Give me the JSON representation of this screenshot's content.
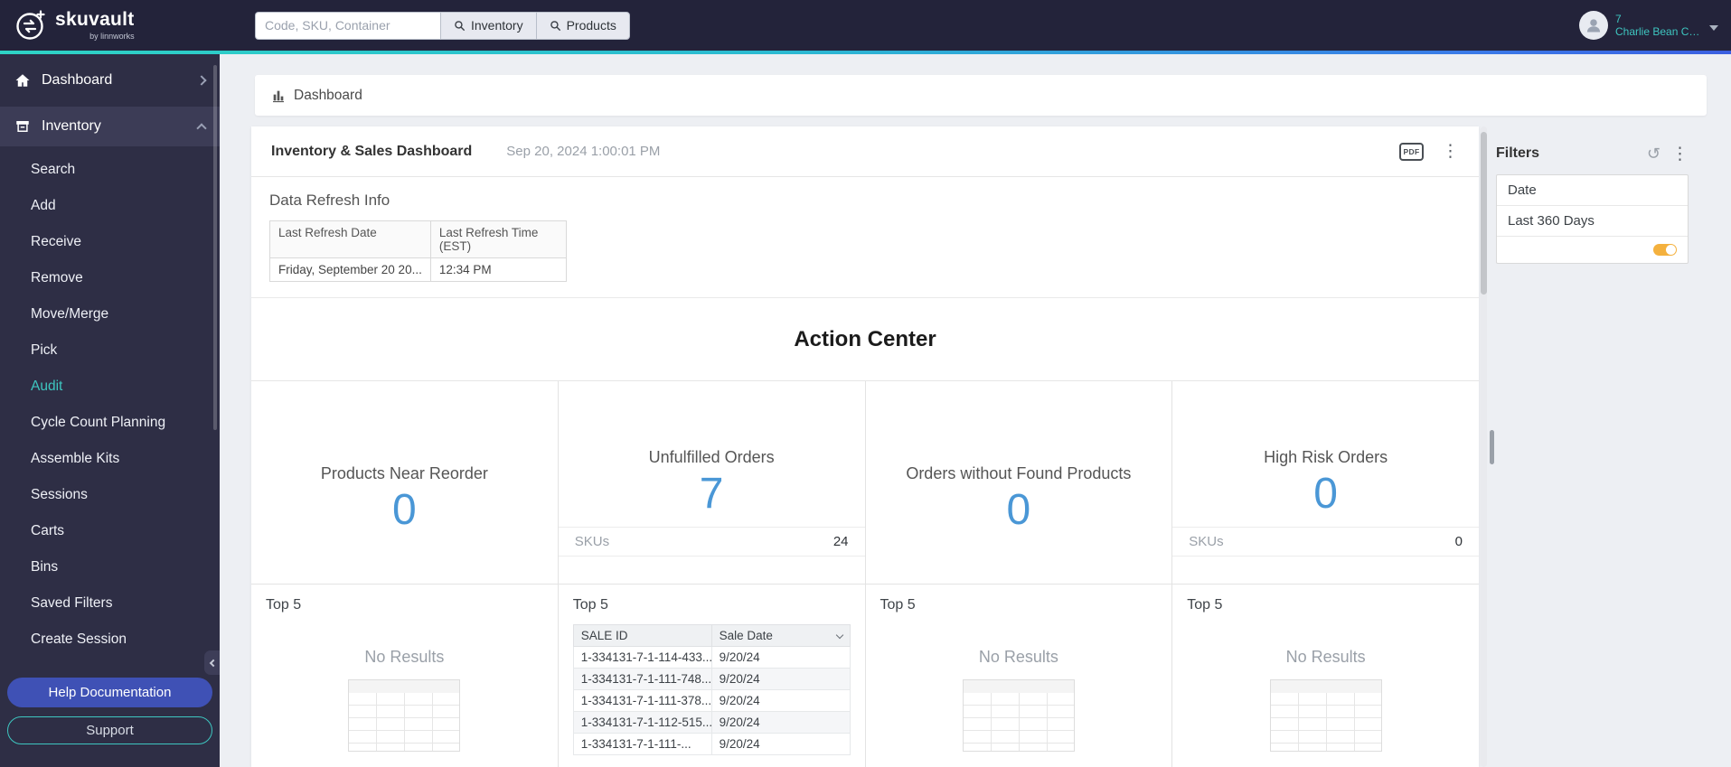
{
  "topbar": {
    "brand": {
      "name": "skuvault",
      "tagline": "by linnworks"
    },
    "search_placeholder": "Code, SKU, Container",
    "inventory_button": "Inventory",
    "products_button": "Products",
    "user": {
      "badge": "7",
      "name": "Charlie Bean Co..."
    }
  },
  "sidebar": {
    "dashboard_label": "Dashboard",
    "inventory_label": "Inventory",
    "items": [
      "Search",
      "Add",
      "Receive",
      "Remove",
      "Move/Merge",
      "Pick",
      "Audit",
      "Cycle Count Planning",
      "Assemble Kits",
      "Sessions",
      "Carts",
      "Bins",
      "Saved Filters",
      "Create Session"
    ],
    "active_item": "Audit",
    "help_button": "Help Documentation",
    "support_button": "Support"
  },
  "breadcrumb": {
    "label": "Dashboard"
  },
  "panel": {
    "title": "Inventory & Sales Dashboard",
    "timestamp": "Sep 20, 2024 1:00:01 PM",
    "pdf_label": "PDF",
    "refresh": {
      "heading": "Data Refresh Info",
      "col1": "Last Refresh Date",
      "col2": "Last Refresh Time (EST)",
      "date": "Friday, September 20 20...",
      "time": "12:34 PM"
    },
    "action_center_title": "Action Center",
    "kpis": [
      {
        "label": "Products Near Reorder",
        "value": "0"
      },
      {
        "label": "Unfulfilled Orders",
        "value": "7",
        "sub_label": "SKUs",
        "sub_value": "24"
      },
      {
        "label": "Orders without Found Products",
        "value": "0"
      },
      {
        "label": "High Risk Orders",
        "value": "0",
        "sub_label": "SKUs",
        "sub_value": "0"
      }
    ],
    "top5_label": "Top 5",
    "no_results": "No Results",
    "orders": {
      "col1": "SALE ID",
      "col2": "Sale Date",
      "rows": [
        {
          "id": "1-334131-7-1-114-433...",
          "date": "9/20/24"
        },
        {
          "id": "1-334131-7-1-111-748...",
          "date": "9/20/24"
        },
        {
          "id": "1-334131-7-1-111-378...",
          "date": "9/20/24"
        },
        {
          "id": "1-334131-7-1-112-515...",
          "date": "9/20/24"
        },
        {
          "id": "1-334131-7-1-111-...",
          "date": "9/20/24"
        }
      ]
    }
  },
  "filters": {
    "title": "Filters",
    "date_label": "Date",
    "date_value": "Last 360 Days"
  },
  "icons": {
    "kebab": "⋮",
    "reset": "↺"
  },
  "colors": {
    "accent_teal": "#3ec6c0",
    "accent_blue": "#4a97d6",
    "help_indigo": "#3f51b5"
  }
}
